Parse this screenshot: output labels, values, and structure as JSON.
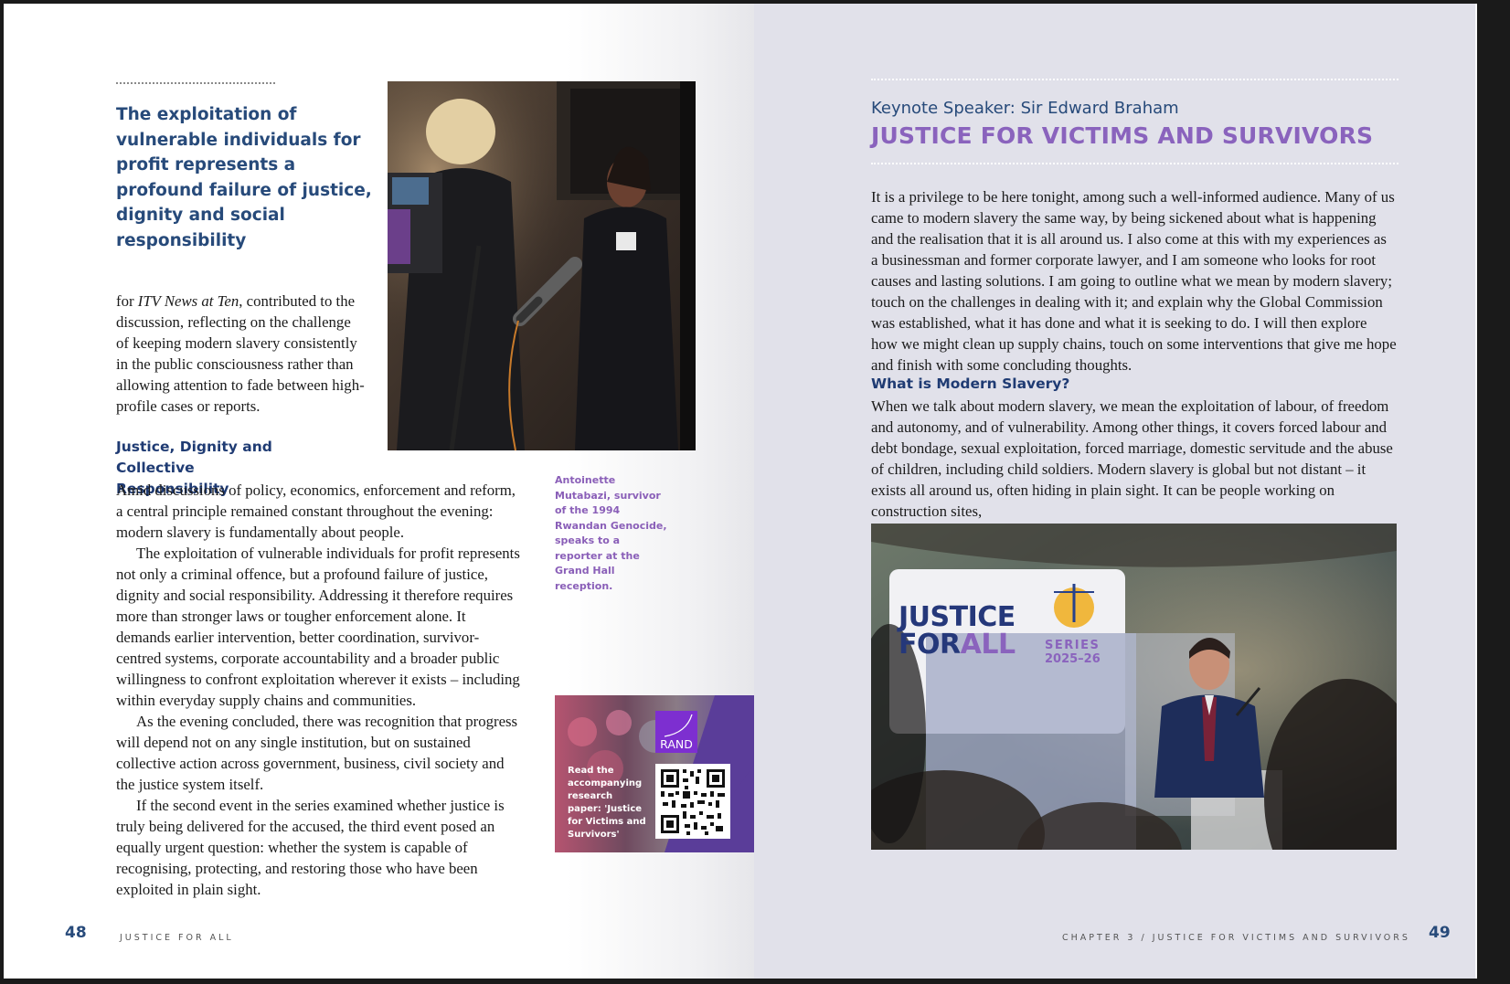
{
  "left": {
    "pull_quote": "The exploitation of vulnerable individuals for profit represents a profound failure of justice, dignity and social responsibility",
    "intro": {
      "lead": "for ",
      "italic": "ITV News at Ten",
      "rest": ", contributed to the discussion, reflecting on the challenge of keeping modern slavery consistently in the public consciousness rather than allowing attention to fade between high-profile cases or reports."
    },
    "subheading": "Justice, Dignity and Collective Responsibility",
    "paragraphs": [
      "Amid discussions of policy, economics, enforcement and reform, a central principle remained constant throughout the evening: modern slavery is fundamentally about people.",
      "The exploitation of vulnerable individuals for profit represents not only a criminal offence, but a profound failure of justice, dignity and social responsibility. Addressing it therefore requires more than stronger laws or tougher enforcement alone. It demands earlier intervention, better coordination, survivor-centred systems, corporate accountability and a broader public willingness to confront exploitation wherever it exists – including within everyday supply chains and communities.",
      "As the evening concluded, there was recognition that progress will depend not on any single institution, but on sustained collective action across government, business, civil society and the justice system itself.",
      "If the second event in the series examined whether justice is truly being delivered for the accused, the third event posed an equally urgent question: whether the system is capable of recognising, protecting, and restoring those who have been exploited in plain sight."
    ],
    "photo_caption": "Antoinette Mutabazi, survivor of the 1994 Rwandan Genocide, speaks to a reporter at the Grand Hall reception.",
    "rand_promo": {
      "logo": "RAND",
      "text": "Read the accompanying research paper: 'Justice for Victims and Survivors'"
    },
    "page_number": "48",
    "running_head": "JUSTICE FOR ALL"
  },
  "right": {
    "kicker": "Keynote Speaker: Sir Edward Braham",
    "title": "JUSTICE FOR VICTIMS AND SURVIVORS",
    "intro_paragraph": "It is a privilege to be here tonight, among such a well-informed audience. Many of us came to modern slavery the same way, by being sickened about what is happening and the realisation that it is all around us. I also come at this with my experiences as a businessman and former corporate lawyer, and I am someone who looks for root causes and lasting solutions. I am going to outline what we mean by modern slavery; touch on the challenges in dealing with it; and explain why the Global Commission was established, what it has done and what it is seeking to do. I will then explore how we might clean up supply chains, touch on some interventions that give me hope and finish with some concluding thoughts.",
    "subheading": "What is Modern Slavery?",
    "section_paragraph": "When we talk about modern slavery, we mean the exploitation of labour, of freedom and autonomy, and of vulnerability. Among other things, it covers forced labour and debt bondage, sexual exploitation, forced marriage, domestic servitude and the abuse of children, including child soldiers. Modern slavery is global but not distant – it exists all around us, often hiding in plain sight. It can be people working on construction sites,",
    "photo_banner": {
      "line1": "JUSTICE",
      "line2a": "FOR",
      "line2b": "ALL",
      "series": "SERIES",
      "years": "2025–26"
    },
    "page_number": "49",
    "running_head_chapter": "CHAPTER 3",
    "running_head_sep": "/",
    "running_head_title": "JUSTICE FOR VICTIMS AND SURVIVORS"
  },
  "colors": {
    "navy": "#274a7a",
    "purple": "#8a63bd",
    "right_page_bg": "#e1e1ea",
    "rand_purple": "#5a3d99"
  }
}
